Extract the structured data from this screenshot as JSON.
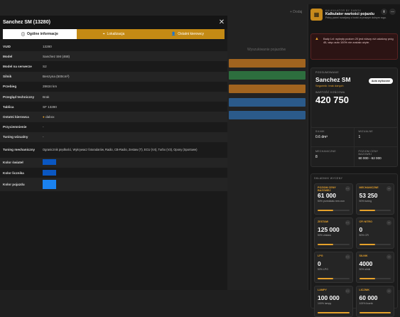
{
  "background": {
    "top": "+ Dodaj",
    "mid": "Wyszukiwanie pojazdów",
    "small": [
      "dbbox",
      "dbbox",
      "dbbox",
      "dbbox"
    ]
  },
  "modal": {
    "title": "Sanchez SM (13280)",
    "tabs": [
      {
        "label": "Ogólne informacje",
        "icon": "info-icon"
      },
      {
        "label": "Lokalizacja",
        "icon": "map-pin-icon"
      },
      {
        "label": "Ostatni kierowcy",
        "icon": "user-icon"
      }
    ],
    "rows": [
      {
        "k": "VUID",
        "v": "13280"
      },
      {
        "k": "Model",
        "v": "Sanchez SM (468)"
      },
      {
        "k": "Model na serwerze",
        "v": "S2"
      },
      {
        "k": "Silnik",
        "v": "Benzyna (500cm³)"
      },
      {
        "k": "Przebieg",
        "v": "28634 km"
      },
      {
        "k": "Przegląd techniczny",
        "v": "Brak"
      },
      {
        "k": "Tablica",
        "v": "SF 13280"
      },
      {
        "k": "Ostatni kierowca",
        "v": "dabox"
      },
      {
        "k": "Przyciemnienie",
        "v": "-"
      },
      {
        "k": "Tuning wizualny",
        "v": "-"
      },
      {
        "k": "Tuning mechaniczny",
        "v": "Ogranicznik prędkości, Wykrywacz fotoradarów, Radio, CB-Radio, Zestaw (T), ECU (V4), Turbo (V3), Opony (Sportowe)"
      },
      {
        "k": "Kolor świateł",
        "v": ""
      },
      {
        "k": "Kolor licznika",
        "v": ""
      },
      {
        "k": "Kolor pojazdu",
        "v": ""
      }
    ]
  },
  "panel": {
    "subtitle": "KALKULATOR BY DABOX",
    "title": "Kalkulator wartości pojazdu",
    "desc": "Pełny panel rozwijany z boxki w prawym dolnym rogu.",
    "warning": "Bady Lvl: wykryty poziom 20 jest niższy niż ustalony próg 45, więc auto 100% nie zostało użyte.",
    "summary_label": "PODSUMOWANIE",
    "name": "Sanchez SM",
    "sub": "Segońnik: brak danych",
    "pill": "Auto wyliczone",
    "value_label": "WARTOŚĆ KOŃCOWA",
    "value": "420 750",
    "stats": [
      {
        "l": "SILNIK",
        "v": "0.6 dm³"
      },
      {
        "l": "WIZUALNE",
        "v": "1"
      },
      {
        "l": "MECHANICZNE",
        "v": "8"
      },
      {
        "l": "POZIOM CENY BAZOWEJ",
        "v": "60 000 - 62 000"
      }
    ],
    "section_label": "SKŁADNIKI WYCENY",
    "cards": [
      {
        "n": "POZIOM CENY BAZOWEJ",
        "v": "61 000",
        "p": "50% przedziału rem-non",
        "fill": 0.5
      },
      {
        "n": "MECHANICZNE",
        "v": "53 250",
        "p": "50% tuning",
        "fill": 0.5
      },
      {
        "n": "ZESTAW",
        "v": "125 000",
        "p": "50% zestaw",
        "fill": 0.5
      },
      {
        "n": "CFI NITRO",
        "v": "0",
        "p": "50% CFI",
        "fill": 0.5
      },
      {
        "n": "LPG",
        "v": "0",
        "p": "50% LPG",
        "fill": 0.5
      },
      {
        "n": "SILNIK",
        "v": "4000",
        "p": "50% silnik",
        "fill": 0.5
      },
      {
        "n": "LAMPY",
        "v": "100 000",
        "p": "100% lampy",
        "fill": 1.0
      },
      {
        "n": "LICZNIK",
        "v": "60 000",
        "p": "100% licznik",
        "fill": 1.0
      }
    ]
  },
  "colors": {
    "accent": "#c48a14",
    "light_color": "#0a57c2",
    "vehicle_color": "#1a82f0"
  }
}
